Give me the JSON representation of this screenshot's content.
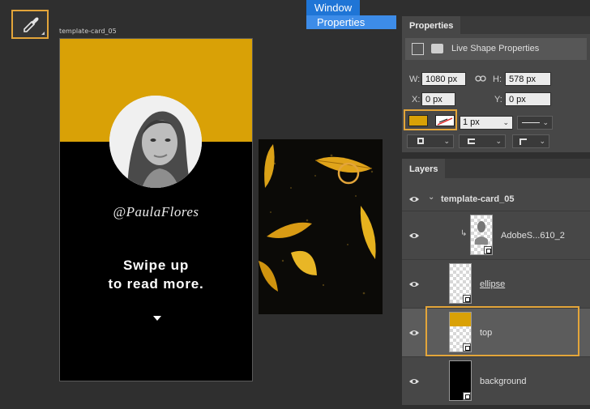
{
  "document": {
    "artboard_label": "template-card_05",
    "handle": "@PaulaFlores",
    "cta_line1": "Swipe up",
    "cta_line2": "to read more."
  },
  "menu": {
    "window_label": "Window",
    "properties_label": "Properties"
  },
  "properties": {
    "tab_label": "Properties",
    "section_label": "Live Shape Properties",
    "w_label": "W:",
    "w_value": "1080 px",
    "h_label": "H:",
    "h_value": "578 px",
    "x_label": "X:",
    "x_value": "0 px",
    "y_label": "Y:",
    "y_value": "0 px",
    "stroke_width": "1 px",
    "fill_color": "#d9a106"
  },
  "layers": {
    "tab_label": "Layers",
    "group_name": "template-card_05",
    "items": [
      {
        "name": "AdobeS...610_2"
      },
      {
        "name": "ellipse"
      },
      {
        "name": "top"
      },
      {
        "name": "background"
      }
    ]
  },
  "colors": {
    "accent_yellow": "#d9a106",
    "selection_orange": "#e3a53a",
    "menu_blue": "#1f75d6"
  }
}
